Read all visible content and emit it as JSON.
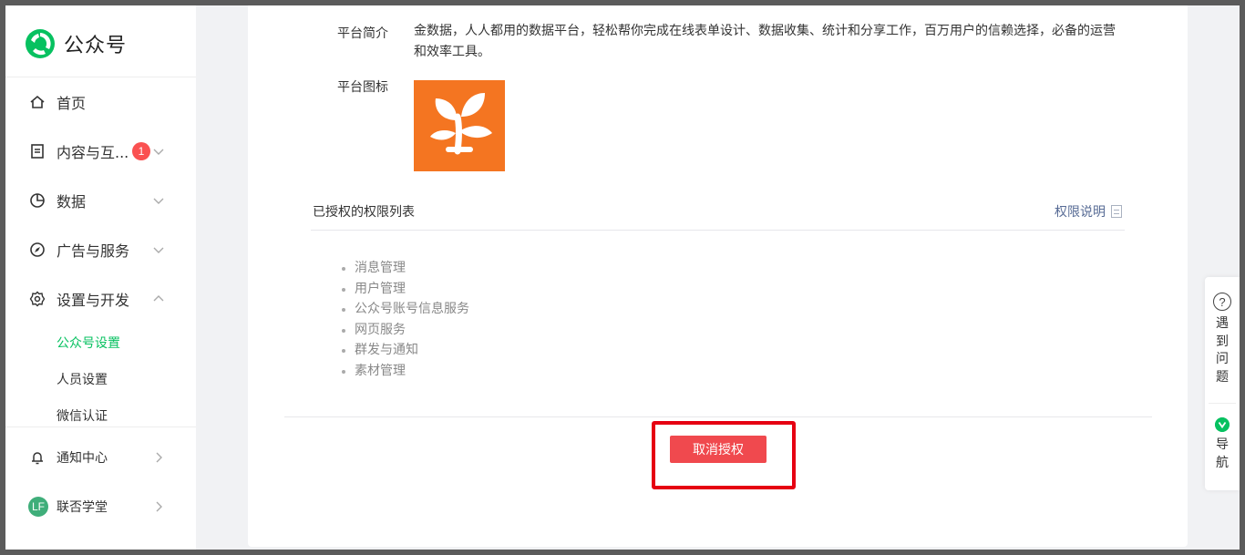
{
  "app": {
    "name": "公众号"
  },
  "sidebar": {
    "items": [
      {
        "label": "首页"
      },
      {
        "label": "内容与互...",
        "badge": "1"
      },
      {
        "label": "数据"
      },
      {
        "label": "广告与服务"
      },
      {
        "label": "设置与开发"
      }
    ],
    "subitems": [
      {
        "label": "公众号设置",
        "active": true
      },
      {
        "label": "人员设置"
      },
      {
        "label": "微信认证"
      }
    ],
    "notify": {
      "label": "通知中心"
    },
    "account": {
      "label": "联否学堂",
      "avatar_text": "LF"
    }
  },
  "main": {
    "intro_label": "平台简介",
    "intro_text": "金数据，人人都用的数据平台，轻松帮你完成在线表单设计、数据收集、统计和分享工作，百万用户的信赖选择，必备的运营和效率工具。",
    "icon_label": "平台图标",
    "perm_title": "已授权的权限列表",
    "perm_link": "权限说明",
    "permissions": [
      "消息管理",
      "用户管理",
      "公众号账号信息服务",
      "网页服务",
      "群发与通知",
      "素材管理"
    ],
    "cancel_button": "取消授权"
  },
  "float": {
    "help_chars": [
      "遇",
      "到",
      "问",
      "题"
    ],
    "nav_chars": [
      "导",
      "航"
    ]
  },
  "colors": {
    "accent": "#07c160",
    "danger": "#f0494e",
    "platform_icon": "#f47521",
    "highlight": "#e60012"
  }
}
